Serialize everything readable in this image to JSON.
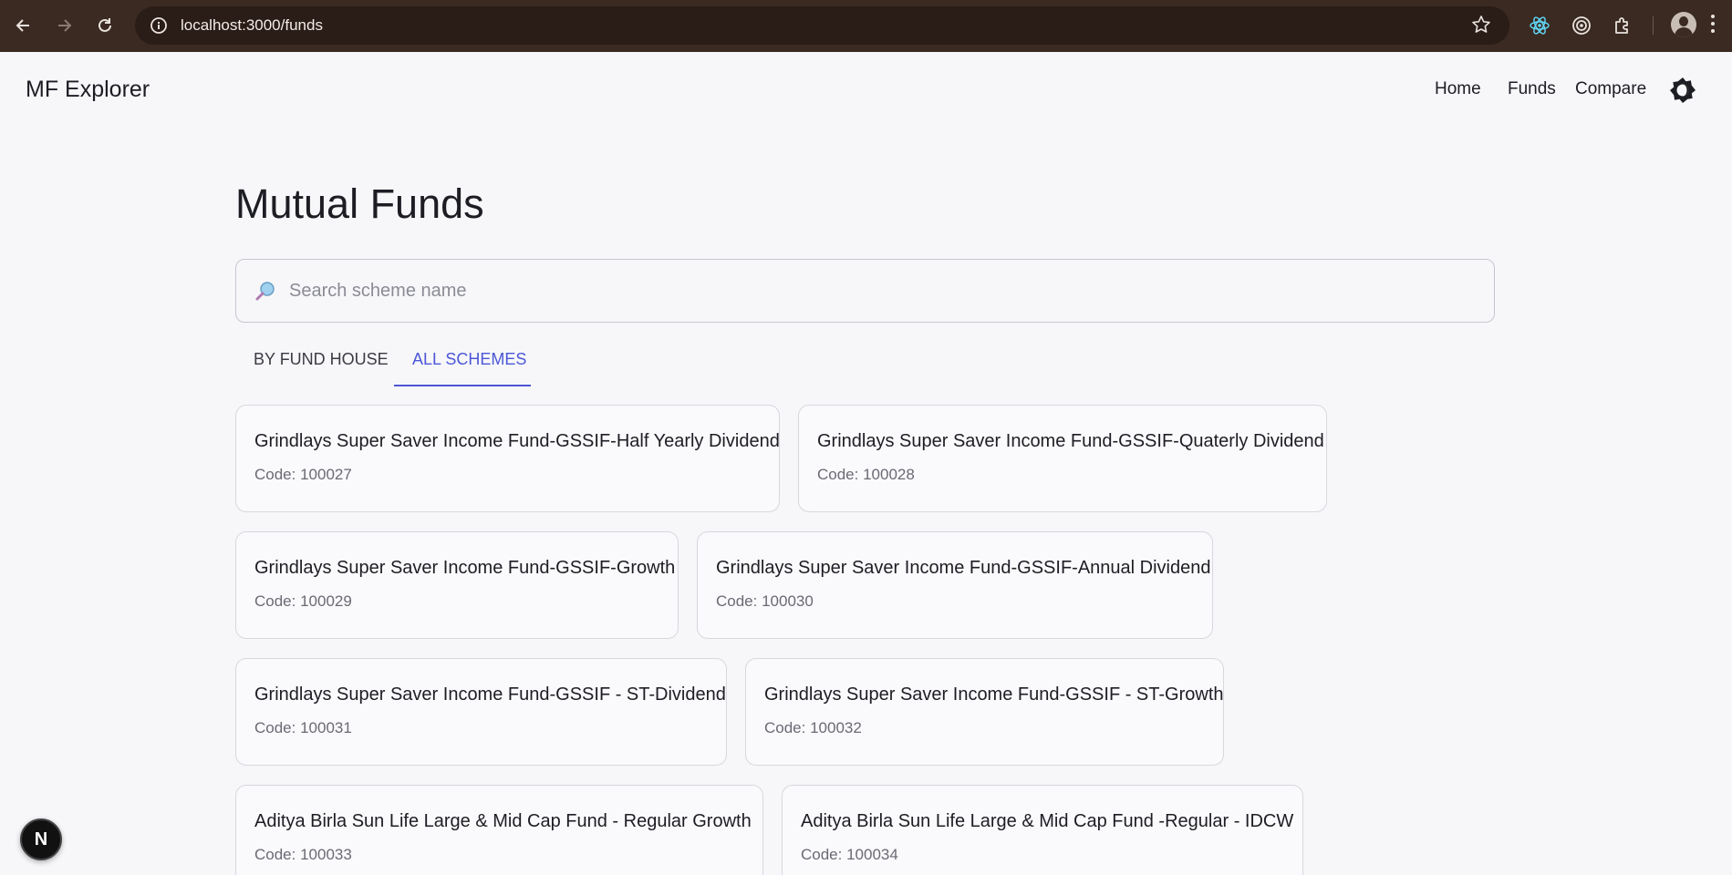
{
  "browser": {
    "url": "localhost:3000/funds"
  },
  "app": {
    "brand": "MF Explorer",
    "nav": {
      "home": "Home",
      "funds": "Funds",
      "compare": "Compare"
    }
  },
  "page": {
    "title": "Mutual Funds",
    "search_placeholder": "Search scheme name",
    "search_value": "",
    "tabs": [
      {
        "label": "BY FUND HOUSE",
        "active": false
      },
      {
        "label": "ALL SCHEMES",
        "active": true
      }
    ],
    "schemes": [
      {
        "name": "Grindlays Super Saver Income Fund-GSSIF-Half Yearly Dividend",
        "code": "Code: 100027"
      },
      {
        "name": "Grindlays Super Saver Income Fund-GSSIF-Quaterly Dividend",
        "code": "Code: 100028"
      },
      {
        "name": "Grindlays Super Saver Income Fund-GSSIF-Growth",
        "code": "Code: 100029"
      },
      {
        "name": "Grindlays Super Saver Income Fund-GSSIF-Annual Dividend",
        "code": "Code: 100030"
      },
      {
        "name": "Grindlays Super Saver Income Fund-GSSIF - ST-Dividend",
        "code": "Code: 100031"
      },
      {
        "name": "Grindlays Super Saver Income Fund-GSSIF - ST-Growth",
        "code": "Code: 100032"
      },
      {
        "name": "Aditya Birla Sun Life Large & Mid Cap Fund - Regular Growth",
        "code": "Code: 100033"
      },
      {
        "name": "Aditya Birla Sun Life Large & Mid Cap Fund -Regular - IDCW",
        "code": "Code: 100034"
      }
    ]
  },
  "dev_badge": "N",
  "colors": {
    "accent": "#4c57d6",
    "chrome": "#3a2a22",
    "background": "#f7f7fa"
  }
}
